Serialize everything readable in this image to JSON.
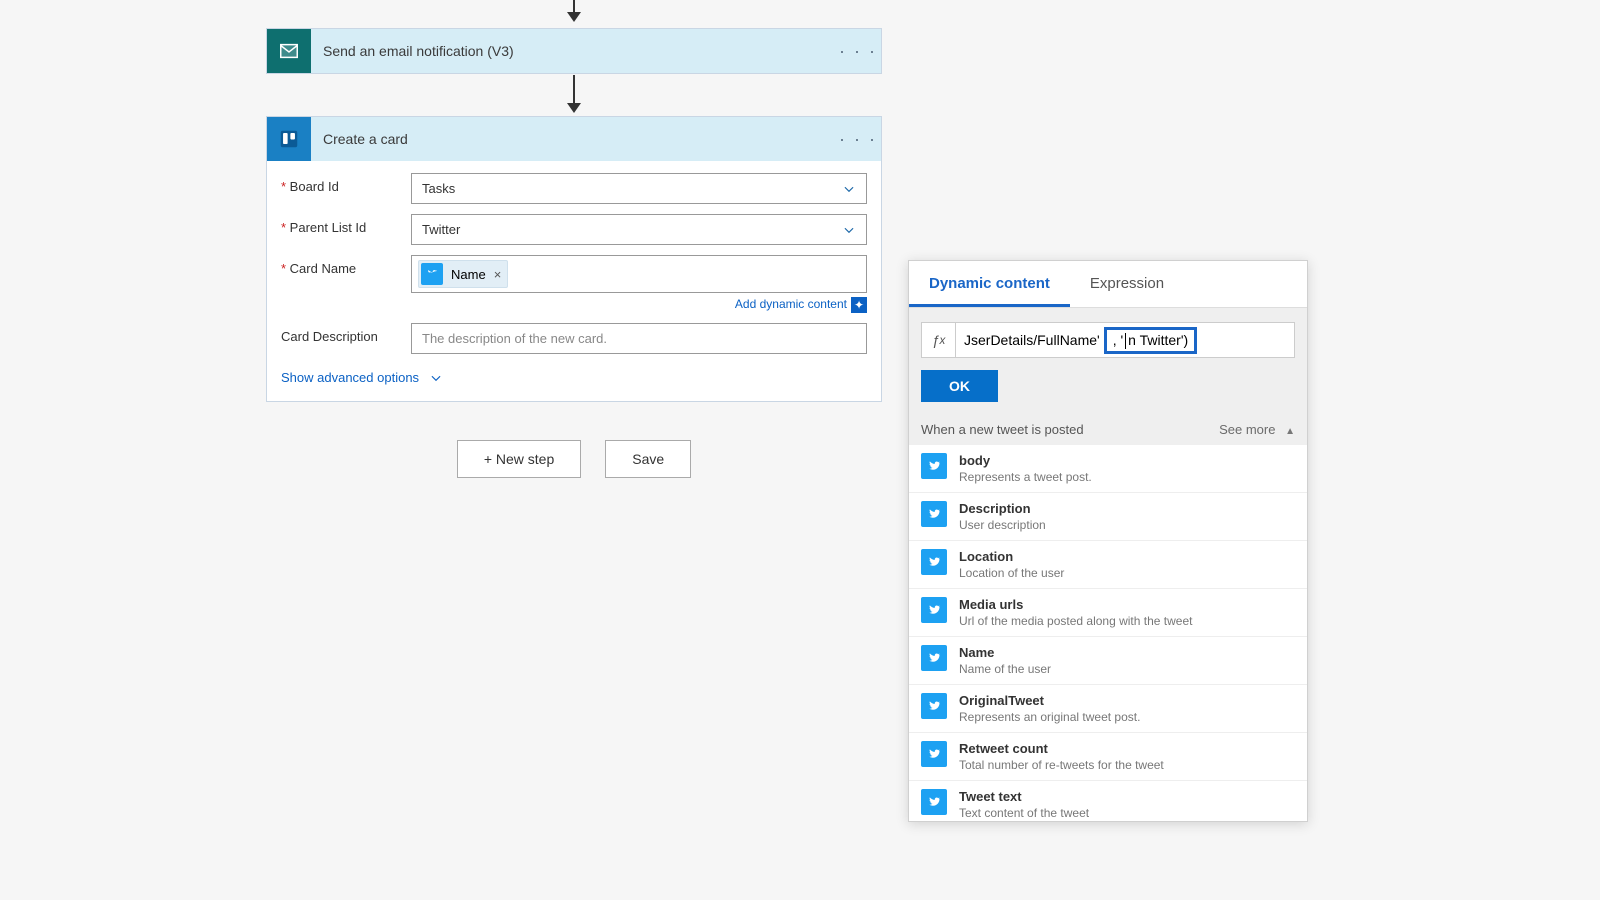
{
  "arrows": {},
  "emailStep": {
    "title": "Send an email notification (V3)"
  },
  "trelloStep": {
    "title": "Create a card",
    "fields": {
      "boardId": {
        "label": "Board Id",
        "value": "Tasks"
      },
      "parentListId": {
        "label": "Parent List Id",
        "value": "Twitter"
      },
      "cardName": {
        "label": "Card Name",
        "tokenLabel": "Name"
      },
      "cardDesc": {
        "label": "Card Description",
        "placeholder": "The description of the new card."
      }
    },
    "addDynamic": "Add dynamic content",
    "advancedOptions": "Show advanced options"
  },
  "footer": {
    "newStep": "+ New step",
    "save": "Save"
  },
  "popout": {
    "tabs": {
      "dynamic": "Dynamic content",
      "expression": "Expression"
    },
    "expression": {
      "prefix": "JserDetails/FullName'",
      "highlightPrefix": ", '",
      "highlightSuffix": "n Twitter')"
    },
    "ok": "OK",
    "section": {
      "title": "When a new tweet is posted",
      "seeMore": "See more"
    },
    "items": [
      {
        "title": "body",
        "desc": "Represents a tweet post."
      },
      {
        "title": "Description",
        "desc": "User description"
      },
      {
        "title": "Location",
        "desc": "Location of the user"
      },
      {
        "title": "Media urls",
        "desc": "Url of the media posted along with the tweet"
      },
      {
        "title": "Name",
        "desc": "Name of the user"
      },
      {
        "title": "OriginalTweet",
        "desc": "Represents an original tweet post."
      },
      {
        "title": "Retweet count",
        "desc": "Total number of re-tweets for the tweet"
      },
      {
        "title": "Tweet text",
        "desc": "Text content of the tweet"
      }
    ]
  }
}
